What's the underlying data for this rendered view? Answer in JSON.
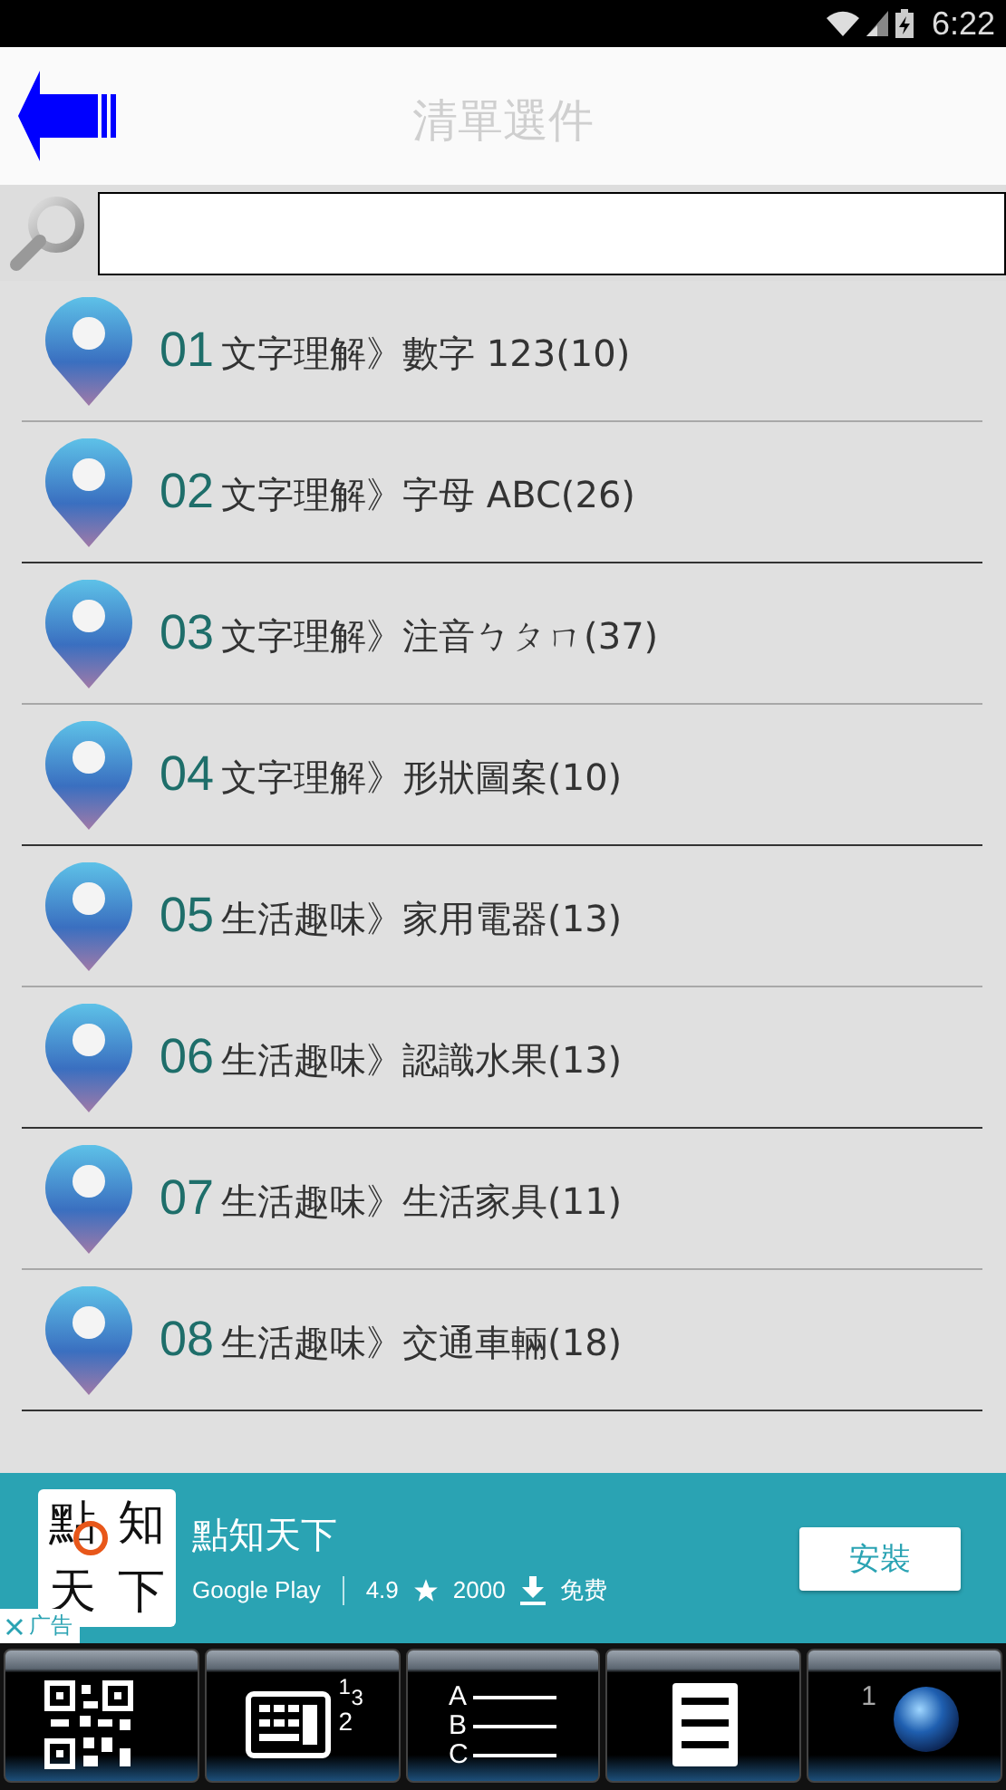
{
  "status_bar": {
    "time": "6:22"
  },
  "header": {
    "title": "清單選件"
  },
  "items": [
    {
      "number": "01",
      "label": "文字理解》數字 123(10)"
    },
    {
      "number": "02",
      "label": "文字理解》字母 ABC(26)"
    },
    {
      "number": "03",
      "label": "文字理解》注音ㄅㄆㄇ(37)"
    },
    {
      "number": "04",
      "label": "文字理解》形狀圖案(10)"
    },
    {
      "number": "05",
      "label": "生活趣味》家用電器(13)"
    },
    {
      "number": "06",
      "label": "生活趣味》認識水果(13)"
    },
    {
      "number": "07",
      "label": "生活趣味》生活家具(11)"
    },
    {
      "number": "08",
      "label": "生活趣味》交通車輛(18)"
    }
  ],
  "ad": {
    "icon_text": [
      "點",
      "知",
      "天",
      "下"
    ],
    "title": "點知天下",
    "store": "Google Play",
    "rating": "4.9",
    "downloads": "2000",
    "price": "免费",
    "button": "安裝",
    "ad_label": "广告"
  },
  "toolbar": [
    {
      "kind": "qr"
    },
    {
      "kind": "keypad",
      "marks": [
        "1",
        "3",
        "2"
      ]
    },
    {
      "kind": "abc",
      "marks": [
        "A",
        "B",
        "C"
      ]
    },
    {
      "kind": "list"
    },
    {
      "kind": "globe",
      "marks": [
        "1"
      ]
    }
  ]
}
